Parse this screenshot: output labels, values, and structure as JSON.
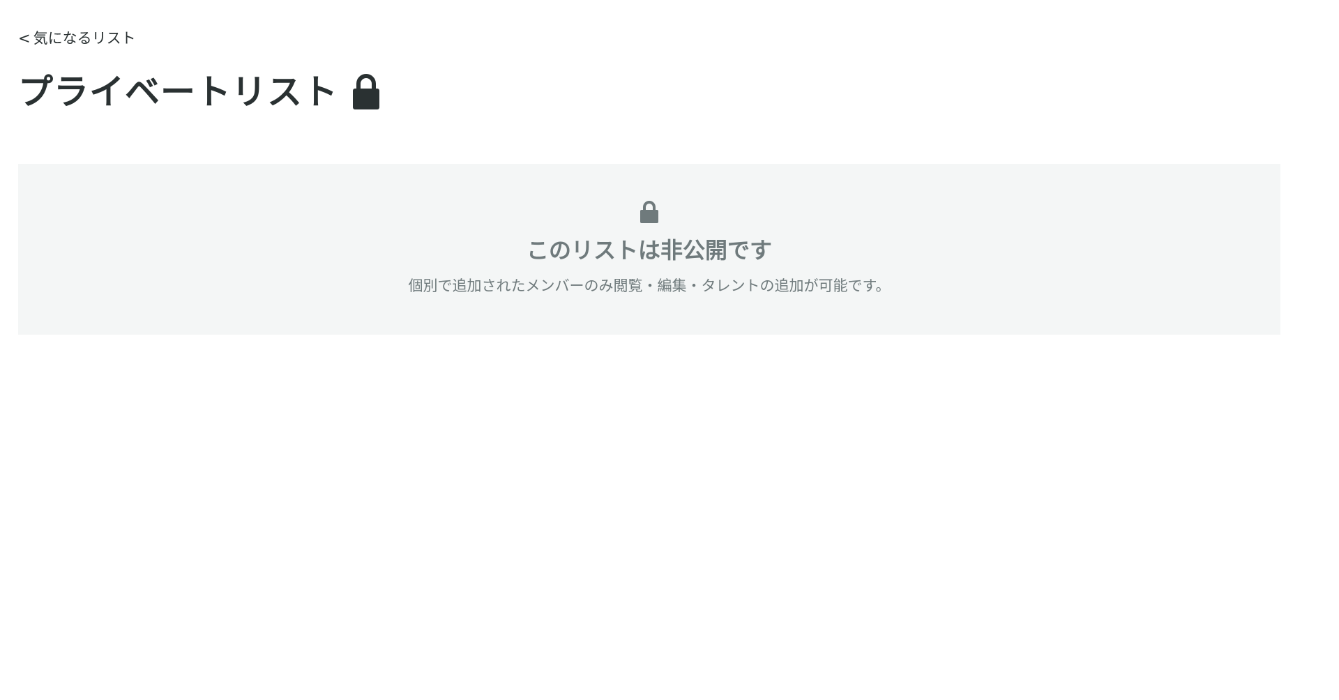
{
  "nav": {
    "back_chevron": "<",
    "back_label": "気になるリスト"
  },
  "header": {
    "title": "プライベートリスト",
    "icon": "lock-icon"
  },
  "notice": {
    "icon": "lock-icon",
    "title": "このリストは非公開です",
    "description": "個別で追加されたメンバーのみ閲覧・編集・タレントの追加が可能です。"
  },
  "colors": {
    "text_primary": "#2a3132",
    "text_muted": "#6f7a7c",
    "panel_background": "#f4f6f6"
  }
}
